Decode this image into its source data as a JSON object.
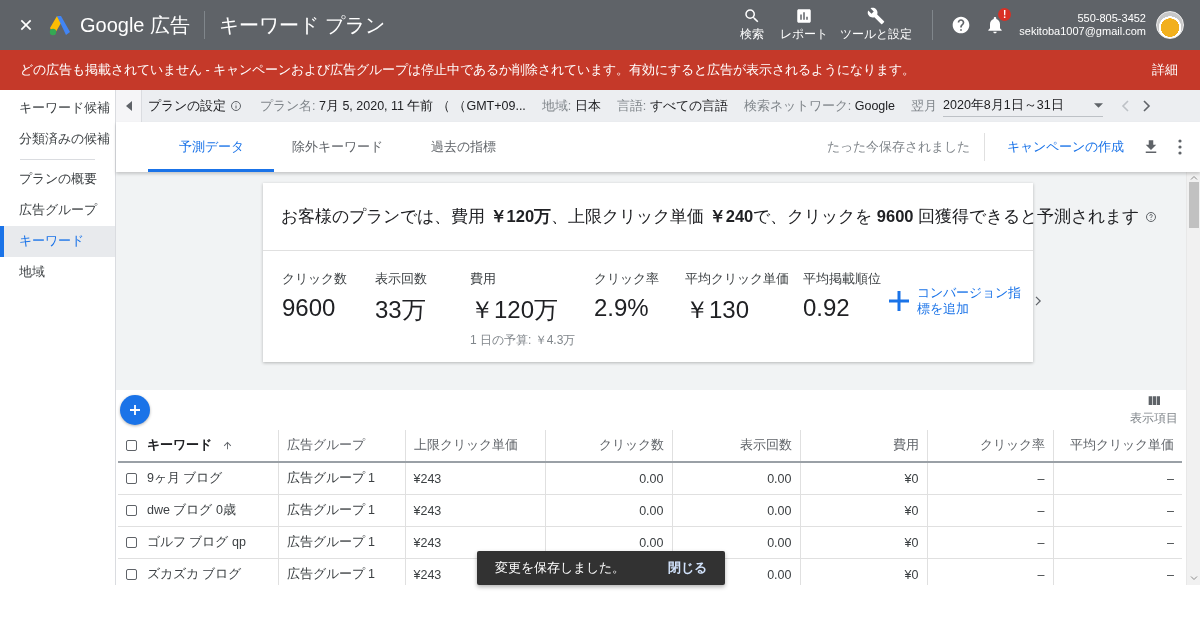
{
  "header": {
    "product": "Google 広告",
    "page_title": "キーワード プラン",
    "tools": [
      {
        "kind": "search",
        "label": "検索"
      },
      {
        "kind": "report",
        "label": "レポート"
      },
      {
        "kind": "tools",
        "label": "ツールと設定"
      }
    ],
    "notification_badge": "!",
    "account": {
      "phone": "550-805-3452",
      "email": "sekitoba1007@gmail.com"
    }
  },
  "alert": {
    "message": "どの広告も掲載されていません - キャンペーンおよび広告グループは停止中であるか削除されています。有効にすると広告が表示されるようになります。",
    "link": "詳細"
  },
  "sidebar": {
    "sections": [
      {
        "items": [
          {
            "label": "キーワード候補",
            "selected": false
          },
          {
            "label": "分類済みの候補",
            "selected": false
          }
        ]
      },
      {
        "items": [
          {
            "label": "プランの概要",
            "selected": false
          },
          {
            "label": "広告グループ",
            "selected": false
          },
          {
            "label": "キーワード",
            "selected": true
          },
          {
            "label": "地域",
            "selected": false
          }
        ]
      }
    ]
  },
  "plan_bar": {
    "title": "プランの設定",
    "fields": [
      {
        "label": "プラン名:",
        "value": "7月 5, 2020, 11 午前 （ （GMT+09..."
      },
      {
        "label": "地域:",
        "value": "日本"
      },
      {
        "label": "言語:",
        "value": "すべての言語"
      },
      {
        "label": "検索ネットワーク:",
        "value": "Google"
      }
    ],
    "period_label": "翌月",
    "period": "2020年8月1日～31日",
    "prev_disabled": true,
    "next_disabled": false
  },
  "tabs": [
    {
      "label": "予測データ",
      "selected": true
    },
    {
      "label": "除外キーワード",
      "selected": false
    },
    {
      "label": "過去の指標",
      "selected": false
    }
  ],
  "save_status": "たった今保存されました",
  "create_campaign": "キャンペーンの作成",
  "summary": {
    "headline": "お客様のプランでは、費用 **￥120万**、上限クリック単価 **￥240**で、クリックを **9600** 回獲得できると予測されます",
    "metrics": [
      {
        "label": "クリック数",
        "value": "9600"
      },
      {
        "label": "表示回数",
        "value": "33万"
      },
      {
        "label": "費用",
        "value": "￥120万",
        "note": "1 日の予算: ￥4.3万"
      },
      {
        "label": "クリック率",
        "value": "2.9%"
      },
      {
        "label": "平均クリック単価",
        "value": "￥130"
      },
      {
        "label": "平均掲載順位",
        "value": "0.92"
      }
    ],
    "add_conversion": "コンバージョン指標を追加"
  },
  "table": {
    "columns_button": "表示項目",
    "header_checked": false,
    "columns": [
      "キーワード",
      "広告グループ",
      "上限クリック単価",
      "クリック数",
      "表示回数",
      "費用",
      "クリック率",
      "平均クリック単価"
    ],
    "rows": [
      {
        "checked": false,
        "cells": [
          "9ヶ月 ブログ",
          "広告グループ 1",
          "¥243",
          "0.00",
          "0.00",
          "¥0",
          "–",
          "–"
        ]
      },
      {
        "checked": false,
        "cells": [
          "dwe ブログ 0歳",
          "広告グループ 1",
          "¥243",
          "0.00",
          "0.00",
          "¥0",
          "–",
          "–"
        ]
      },
      {
        "checked": false,
        "cells": [
          "ゴルフ ブログ qp",
          "広告グループ 1",
          "¥243",
          "0.00",
          "0.00",
          "¥0",
          "–",
          "–"
        ]
      },
      {
        "checked": false,
        "cells": [
          "ズカズカ ブログ",
          "広告グループ 1",
          "¥243",
          null,
          "0.00",
          "¥0",
          "–",
          "–"
        ]
      }
    ]
  },
  "snackbar": {
    "message": "変更を保存しました。",
    "action": "閉じる"
  }
}
